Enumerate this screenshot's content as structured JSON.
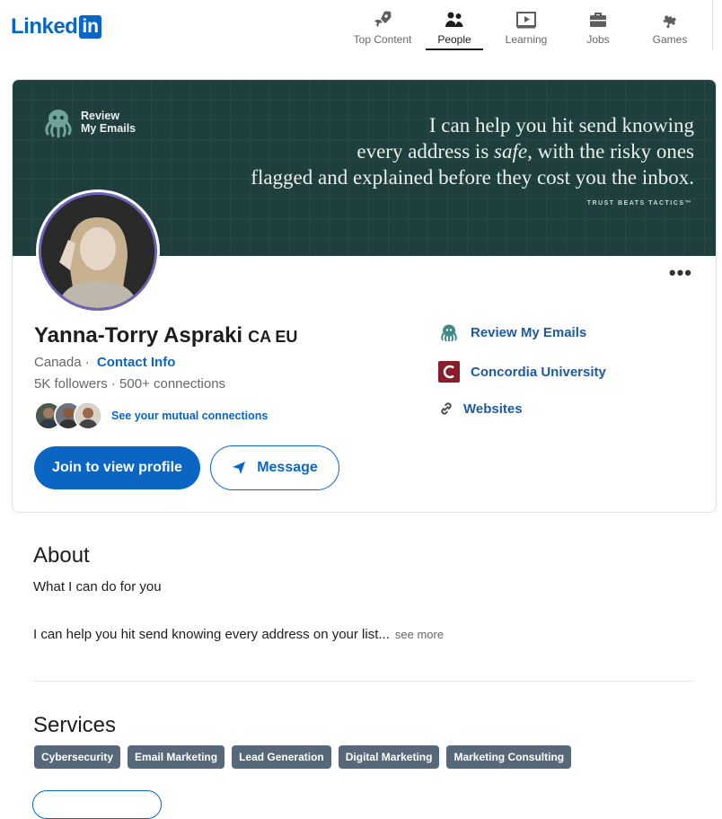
{
  "header": {
    "logo_text": "Linked",
    "logo_box": "in",
    "nav": [
      {
        "label": "Top Content",
        "icon": "rocket-icon"
      },
      {
        "label": "People",
        "icon": "people-icon",
        "active": true
      },
      {
        "label": "Learning",
        "icon": "video-icon"
      },
      {
        "label": "Jobs",
        "icon": "briefcase-icon"
      },
      {
        "label": "Games",
        "icon": "puzzle-icon"
      }
    ]
  },
  "banner": {
    "brand_line1": "Review",
    "brand_line2": "My Emails",
    "quote_line1": "I can help you hit send knowing",
    "quote_line2_pre": "every address is ",
    "quote_line2_em": "safe",
    "quote_line2_post": ", with the risky ones",
    "quote_line3": "flagged and explained before they cost you the inbox.",
    "tagline": "TRUST BEATS TACTICS™",
    "bg_color": "#1f3e3e"
  },
  "profile": {
    "name": "Yanna-Torry Aspraki",
    "name_suffix": "CA EU",
    "location": "Canada",
    "separator": "·",
    "contact_info": "Contact Info",
    "followers": "5K followers",
    "connections": "500+ connections",
    "mutual_link": "See your mutual connections",
    "more_label": "•••"
  },
  "actions": {
    "join_label": "Join to view profile",
    "message_label": "Message"
  },
  "side_links": [
    {
      "label": "Review My Emails",
      "icon": "octopus-icon"
    },
    {
      "label": "Concordia University",
      "icon": "concordia-logo-icon"
    },
    {
      "label": "Websites",
      "icon": "link-icon"
    }
  ],
  "about": {
    "title": "About",
    "subtitle": "What I can do for you",
    "body": "I can help you hit send knowing every address on your list...",
    "see_more": "see more"
  },
  "services": {
    "title": "Services",
    "chips": [
      "Cybersecurity",
      "Email Marketing",
      "Lead Generation",
      "Digital Marketing",
      "Marketing Consulting"
    ]
  },
  "colors": {
    "brand_blue": "#0a66c2",
    "chip_bg": "#56687a",
    "avatar_ring": "#6b63b5"
  }
}
